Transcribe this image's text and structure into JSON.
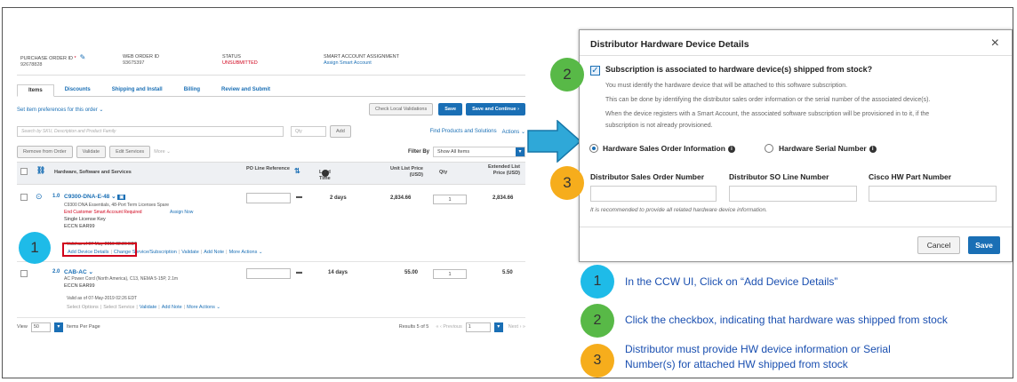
{
  "order": {
    "po_label": "PURCHASE ORDER ID",
    "po_value": "92678828",
    "web_label": "WEB ORDER ID",
    "web_value": "93675397",
    "status_label": "STATUS",
    "status_value": "UNSUBMITTED",
    "sa_label": "SMART ACCOUNT ASSIGNMENT",
    "sa_value": "Assign Smart Account"
  },
  "tabs": [
    "Items",
    "Discounts",
    "Shipping and Install",
    "Billing",
    "Review and Submit"
  ],
  "toolbar": {
    "prefs": "Set item preferences for this order",
    "check": "Check Local Validations",
    "save": "Save",
    "save_continue": "Save and Continue"
  },
  "search": {
    "placeholder": "Search by SKU, Description and Product Family",
    "qty": "Qty",
    "add": "Add",
    "find": "Find Products and Solutions",
    "actions": "Actions"
  },
  "tools": {
    "remove": "Remove from Order",
    "validate": "Validate",
    "edit": "Edit Services",
    "more": "More",
    "filter_label": "Filter By",
    "filter_value": "Show All Items"
  },
  "columns": {
    "hw": "Hardware, Software and Services",
    "po_line": "PO Line Reference",
    "lead": "Lead Time",
    "unit": "Unit List Price (USD)",
    "qty": "Qty",
    "ext": "Extended List Price (USD)"
  },
  "rows": [
    {
      "num": "1.0",
      "sku": "C9300-DNA-E-48",
      "desc": "C9300 DNA Essentials, 48-Port Term Licenses Spare",
      "warn": "End Customer Smart Account Required",
      "assign": "Assign Now",
      "license": "Single License Key",
      "eccn": "ECCN EAR99",
      "lead": "2 days",
      "unit": "2,834.66",
      "qty": "1",
      "ext": "2,834.66",
      "valid": "Valid as of 07-May-2019 02:26 EDT",
      "link1": "Add Device Details",
      "link2": "Change Service/Subscription",
      "link3": "Validate",
      "link4": "Add Note",
      "link5": "More Actions"
    },
    {
      "num": "2.0",
      "sku": "CAB-AC",
      "desc": "AC Power Cord (North America), C13, NEMA 5-15P, 2.1m",
      "eccn": "ECCN EAR99",
      "lead": "14 days",
      "unit": "55.00",
      "qty": "1",
      "ext": "5.50",
      "valid": "Valid as of 07-May-2019 02:26 EDT",
      "link1": "Select Options",
      "link2": "Select Service",
      "link3": "Validate",
      "link4": "Add Note",
      "link5": "More Actions"
    }
  ],
  "pager": {
    "view": "View",
    "per_page": "50",
    "items_label": "Items Per Page",
    "results": "Results 5 of 5",
    "previous": "Previous",
    "page": "1",
    "next": "Next"
  },
  "modal": {
    "title": "Distributor Hardware Device Details",
    "close": "×",
    "question": "Subscription is associated to hardware device(s) shipped from stock?",
    "p1": "You must identify the hardware device that will be attached to this software subscription.",
    "p2": "This can be done by identifying the distributor sales order information or the serial number of the associated device(s).",
    "p3": "When the device registers with a Smart Account, the associated software subscription will be provisioned in to it, if the",
    "p4": "subscription is not already provisioned.",
    "radio1": "Hardware Sales Order Information",
    "radio2": "Hardware Serial Number",
    "f1": "Distributor Sales Order Number",
    "f2": "Distributor SO Line Number",
    "f3": "Cisco HW Part Number",
    "note": "It is recommended to provide all related hardware device information.",
    "cancel": "Cancel",
    "save": "Save"
  },
  "steps": [
    {
      "num": "1",
      "text": "In the CCW UI, Click on “Add Device Details”"
    },
    {
      "num": "2",
      "text": "Click the checkbox, indicating that hardware was shipped from stock"
    },
    {
      "num": "3",
      "text1": "Distributor must provide HW device information or Serial",
      "text2": "Number(s) for attached HW shipped from stock"
    }
  ],
  "colors": {
    "step1": "#1ebbe8",
    "step2": "#58b947",
    "step3": "#f6ad1c",
    "accent": "#1a6fb5",
    "highlight": "#d0021b"
  }
}
